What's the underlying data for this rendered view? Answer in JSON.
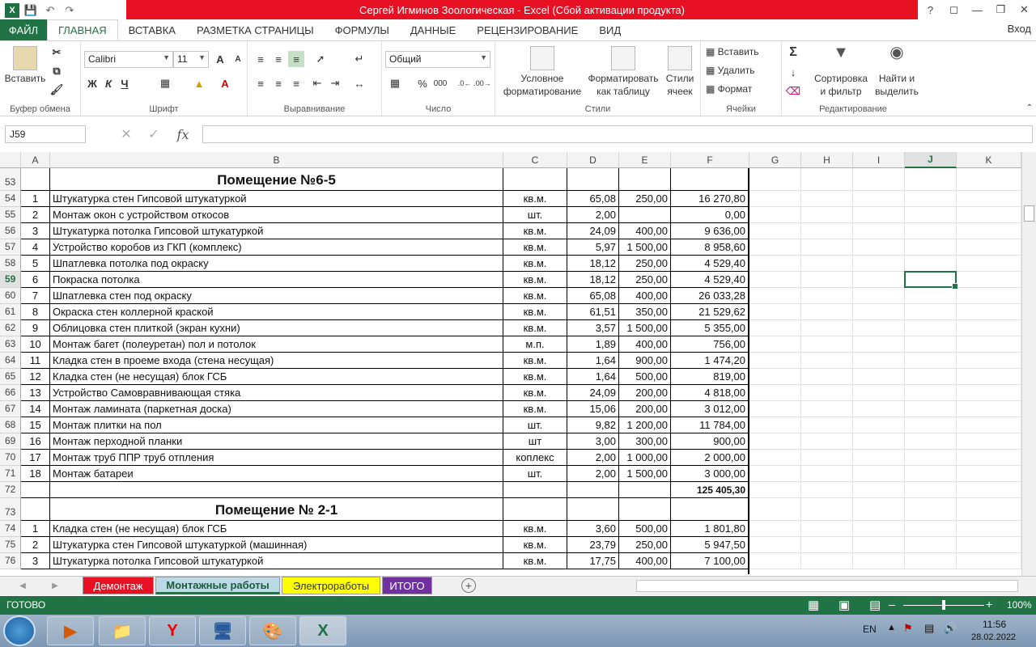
{
  "window": {
    "title": "Сергей Игминов Зоологическая -  Excel (Сбой активации продукта)",
    "qat": {
      "save_icon": "save-icon",
      "undo_icon": "undo-icon",
      "redo_icon": "redo-icon"
    },
    "help": "?",
    "login": "Вход"
  },
  "ribbon_tabs": [
    "ФАЙЛ",
    "ГЛАВНАЯ",
    "ВСТАВКА",
    "РАЗМЕТКА СТРАНИЦЫ",
    "ФОРМУЛЫ",
    "ДАННЫЕ",
    "РЕЦЕНЗИРОВАНИЕ",
    "ВИД"
  ],
  "ribbon": {
    "clipboard": {
      "label": "Буфер обмена",
      "paste": "Вставить"
    },
    "font": {
      "label": "Шрифт",
      "name": "Calibri",
      "size": "11",
      "bold": "Ж",
      "italic": "К",
      "underline": "Ч",
      "grow": "A",
      "shrink": "A"
    },
    "alignment": {
      "label": "Выравнивание"
    },
    "number": {
      "label": "Число",
      "format": "Общий",
      "percent": "%",
      "thousands": "000"
    },
    "styles": {
      "label": "Стили",
      "conditional_line1": "Условное",
      "conditional_line2": "форматирование",
      "table_line1": "Форматировать",
      "table_line2": "как таблицу",
      "cell_line1": "Стили",
      "cell_line2": "ячеек"
    },
    "cells": {
      "label": "Ячейки",
      "insert": "Вставить",
      "delete": "Удалить",
      "format": "Формат"
    },
    "editing": {
      "label": "Редактирование",
      "sort_line1": "Сортировка",
      "sort_line2": "и фильтр",
      "find_line1": "Найти и",
      "find_line2": "выделить"
    }
  },
  "formula_bar": {
    "name_box": "J59",
    "fx": "fx",
    "value": ""
  },
  "columns": [
    "A",
    "B",
    "C",
    "D",
    "E",
    "F",
    "G",
    "H",
    "I",
    "J",
    "K"
  ],
  "selected_column": "J",
  "selected_row": "59",
  "rows": [
    {
      "num": "53",
      "type": "header",
      "title": "Помещение  №6-5"
    },
    {
      "num": "54",
      "a": "1",
      "b": "Штукатурка стен Гипсовой штукатуркой",
      "c": "кв.м.",
      "d": "65,08",
      "e": "250,00",
      "f": "16 270,80"
    },
    {
      "num": "55",
      "a": "2",
      "b": "Монтаж  окон с устройством откосов",
      "c": "шт.",
      "d": "2,00",
      "e": "",
      "f": "0,00"
    },
    {
      "num": "56",
      "a": "3",
      "b": "Штукатурка потолка Гипсовой штукатуркой",
      "c": "кв.м.",
      "d": "24,09",
      "e": "400,00",
      "f": "9 636,00"
    },
    {
      "num": "57",
      "a": "4",
      "b": "Устройство коробов из ГКП (комплекс)",
      "c": "кв.м.",
      "d": "5,97",
      "e": "1 500,00",
      "f": "8 958,60"
    },
    {
      "num": "58",
      "a": "5",
      "b": "Шпатлевка потолка под окраску",
      "c": "кв.м.",
      "d": "18,12",
      "e": "250,00",
      "f": "4 529,40"
    },
    {
      "num": "59",
      "a": "6",
      "b": "Покраска потолка",
      "c": "кв.м.",
      "d": "18,12",
      "e": "250,00",
      "f": "4 529,40"
    },
    {
      "num": "60",
      "a": "7",
      "b": "Шпатлевка стен под окраску",
      "c": "кв.м.",
      "d": "65,08",
      "e": "400,00",
      "f": "26 033,28"
    },
    {
      "num": "61",
      "a": "8",
      "b": "Окраска стен коллерной краской",
      "c": "кв.м.",
      "d": "61,51",
      "e": "350,00",
      "f": "21 529,62"
    },
    {
      "num": "62",
      "a": "9",
      "b": "Облицовка стен плиткой (экран кухни)",
      "c": "кв.м.",
      "d": "3,57",
      "e": "1 500,00",
      "f": "5 355,00"
    },
    {
      "num": "63",
      "a": "10",
      "b": "Монтаж багет (полеуретан) пол и потолок",
      "c": "м.п.",
      "d": "1,89",
      "e": "400,00",
      "f": "756,00"
    },
    {
      "num": "64",
      "a": "11",
      "b": "Кладка стен в проеме входа (стена несущая)",
      "c": "кв.м.",
      "d": "1,64",
      "e": "900,00",
      "f": "1 474,20"
    },
    {
      "num": "65",
      "a": "12",
      "b": "Кладка стен (не несущая) блок ГСБ",
      "c": "кв.м.",
      "d": "1,64",
      "e": "500,00",
      "f": "819,00"
    },
    {
      "num": "66",
      "a": "13",
      "b": "Устройство Самовравнивающая стяка",
      "c": "кв.м.",
      "d": "24,09",
      "e": "200,00",
      "f": "4 818,00"
    },
    {
      "num": "67",
      "a": "14",
      "b": "Монтаж ламината (паркетная доска)",
      "c": "кв.м.",
      "d": "15,06",
      "e": "200,00",
      "f": "3 012,00"
    },
    {
      "num": "68",
      "a": "15",
      "b": "Монтаж плитки на пол",
      "c": "шт.",
      "d": "9,82",
      "e": "1 200,00",
      "f": "11 784,00"
    },
    {
      "num": "69",
      "a": "16",
      "b": "Монтаж перходной планки",
      "c": "шт",
      "d": "3,00",
      "e": "300,00",
      "f": "900,00"
    },
    {
      "num": "70",
      "a": "17",
      "b": "Монтаж труб ППР труб отпления",
      "c": "коплекс",
      "d": "2,00",
      "e": "1 000,00",
      "f": "2 000,00"
    },
    {
      "num": "71",
      "a": "18",
      "b": "Монтаж батареи",
      "c": "шт.",
      "d": "2,00",
      "e": "1 500,00",
      "f": "3 000,00"
    },
    {
      "num": "72",
      "type": "total",
      "a": "",
      "b": "",
      "c": "",
      "d": "",
      "e": "",
      "f": "125 405,30"
    },
    {
      "num": "73",
      "type": "header",
      "title": "Помещение № 2-1"
    },
    {
      "num": "74",
      "a": "1",
      "b": "Кладка стен (не несущая) блок ГСБ",
      "c": "кв.м.",
      "d": "3,60",
      "e": "500,00",
      "f": "1 801,80"
    },
    {
      "num": "75",
      "a": "2",
      "b": "Штукатурка стен Гипсовой штукатуркой (машинная)",
      "c": "кв.м.",
      "d": "23,79",
      "e": "250,00",
      "f": "5 947,50"
    },
    {
      "num": "76",
      "a": "3",
      "b": "Штукатурка потолка Гипсовой штукатуркой",
      "c": "кв.м.",
      "d": "17,75",
      "e": "400,00",
      "f": "7 100,00"
    }
  ],
  "sheets": [
    {
      "label": "Демонтаж",
      "bg": "#e81123",
      "fg": "#ffffff"
    },
    {
      "label": "Монтажные работы",
      "bg": "#bcd9e6",
      "fg": "#1e5a3a",
      "active": true
    },
    {
      "label": "Электроработы",
      "bg": "#ffff00",
      "fg": "#333333"
    },
    {
      "label": "ИТОГО",
      "bg": "#7030a0",
      "fg": "#ffffff"
    }
  ],
  "status": {
    "ready": "ГОТОВО",
    "zoom": "100%"
  },
  "taskbar": {
    "lang": "EN",
    "time": "11:56",
    "date": "28.02.2022"
  },
  "colors": {
    "accent": "#217346",
    "title_error": "#e81123"
  }
}
